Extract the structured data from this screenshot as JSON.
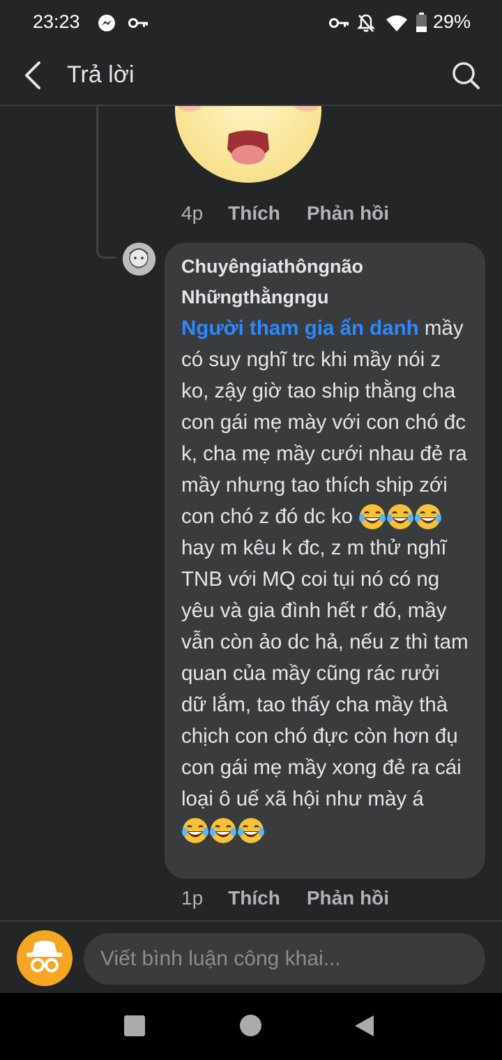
{
  "status_bar": {
    "time": "23:23",
    "battery": "29%"
  },
  "header": {
    "title": "Trả lời"
  },
  "comments": [
    {
      "time": "4p",
      "like": "Thích",
      "reply": "Phản hồi"
    },
    {
      "author_line1": "Chuyêngiathôngnão",
      "author_line2": "Nhữngthằngngu",
      "mention": "Người tham gia ẩn danh",
      "text_a": " mầy có suy nghĩ trc khi mầy nói z ko, zậy giờ tao ship thằng cha con gái mẹ mày với con chó đc k, cha mẹ mầy cưới nhau đẻ ra mầy nhưng tao thích ship zới con chó z đó dc ko ",
      "text_b": " hay m kêu k đc, z m thử nghĩ TNB với MQ coi tụi nó có ng yêu và gia đình hết r đó, mầy vẫn còn ảo dc hả, nếu z thì tam quan của mầy cũng rác rưởi dữ lắm, tao thấy cha mầy thà chịch con chó đực còn hơn đụ con gái mẹ mầy xong đẻ ra cái loại ô uế xã hội như mày á ",
      "time": "1p",
      "like": "Thích",
      "reply": "Phản hồi"
    }
  ],
  "composer": {
    "placeholder": "Viết bình luận công khai..."
  },
  "icons": [
    "messenger-icon",
    "vpn-key-icon",
    "bell-off-icon",
    "wifi-icon",
    "battery-icon",
    "back-arrow-icon",
    "search-icon",
    "laughing-emoji-icon",
    "anonymous-avatar-icon",
    "nav-recent-icon",
    "nav-home-icon",
    "nav-back-icon"
  ],
  "colors": {
    "background": "#242526",
    "bubble": "#3a3b3c",
    "mention": "#2d88ff",
    "muted_text": "#b0b3b8"
  }
}
